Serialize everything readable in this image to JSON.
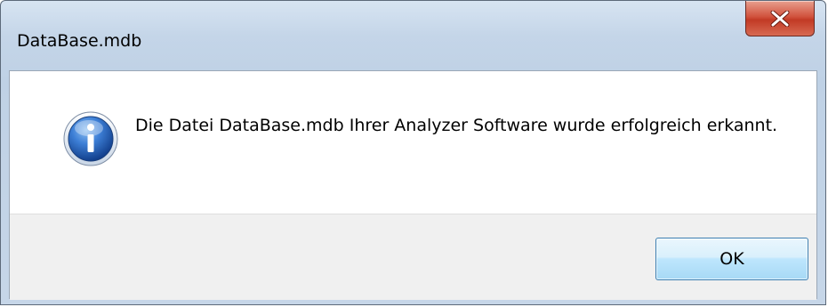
{
  "window": {
    "title": "DataBase.mdb"
  },
  "titlebar": {
    "close_icon": "close-icon"
  },
  "message": {
    "icon": "info-icon",
    "text": "Die Datei DataBase.mdb Ihrer Analyzer Software wurde erfolgreich erkannt."
  },
  "buttons": {
    "ok_label": "OK"
  },
  "colors": {
    "titlebar": "#c4d5e8",
    "close_button": "#c23a25",
    "ok_button_border": "#3c7fb1",
    "footer": "#f0f0f0",
    "info_icon": "#1f5bb0"
  }
}
